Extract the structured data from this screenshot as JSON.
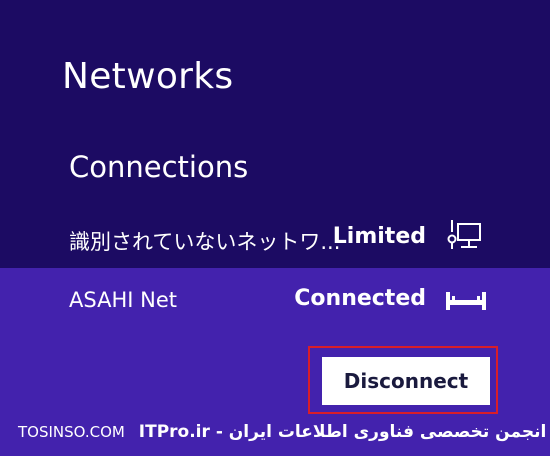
{
  "panel": {
    "title": "Networks",
    "section_label": "Connections"
  },
  "networks": [
    {
      "name": "識別されていないネットワ...",
      "status": "Limited",
      "icon": "limited-network-icon"
    },
    {
      "name": "ASAHI Net",
      "status": "Connected",
      "icon": "wired-connection-icon"
    }
  ],
  "actions": {
    "disconnect_label": "Disconnect"
  },
  "watermark": {
    "site": "TOSINSO.COM",
    "text": "ITPro.ir - انجمن تخصصی فناوری اطلاعات ایران"
  },
  "colors": {
    "background": "#1c0b63",
    "selected_row": "#4322ad",
    "highlight_border": "#d81e2a"
  }
}
